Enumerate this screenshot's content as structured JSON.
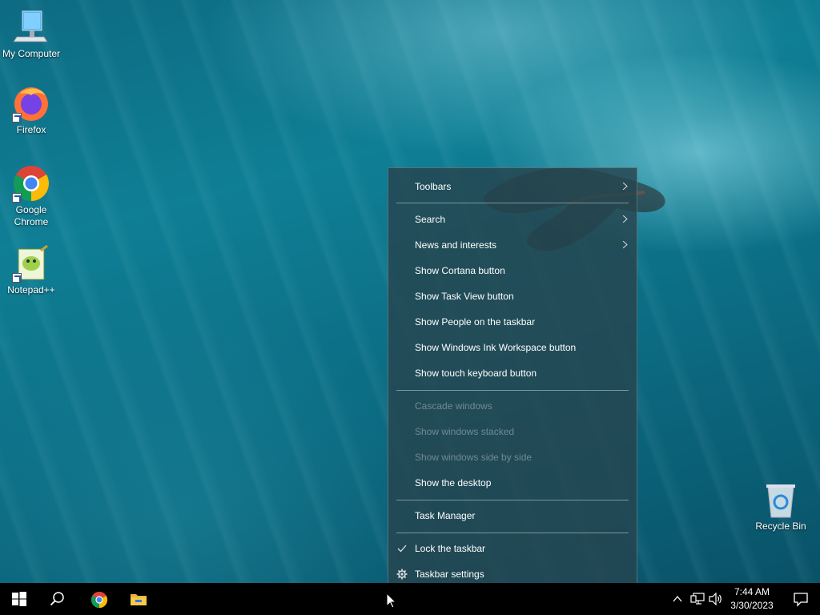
{
  "desktop": {
    "icons": [
      {
        "label": "My Computer",
        "icon": "computer-icon"
      },
      {
        "label": "Firefox",
        "icon": "firefox-icon"
      },
      {
        "label": "Google Chrome",
        "icon": "chrome-icon"
      },
      {
        "label": "Notepad++",
        "icon": "notepadpp-icon"
      },
      {
        "label": "Recycle Bin",
        "icon": "recycle-bin-icon"
      }
    ]
  },
  "context_menu": {
    "items": [
      {
        "label": "Toolbars",
        "submenu": true
      },
      {
        "label": "Search",
        "submenu": true
      },
      {
        "label": "News and interests",
        "submenu": true
      },
      {
        "label": "Show Cortana button"
      },
      {
        "label": "Show Task View button"
      },
      {
        "label": "Show People on the taskbar"
      },
      {
        "label": "Show Windows Ink Workspace button"
      },
      {
        "label": "Show touch keyboard button"
      },
      {
        "label": "Cascade windows",
        "disabled": true
      },
      {
        "label": "Show windows stacked",
        "disabled": true
      },
      {
        "label": "Show windows side by side",
        "disabled": true
      },
      {
        "label": "Show the desktop"
      },
      {
        "label": "Task Manager"
      },
      {
        "label": "Lock the taskbar",
        "checked": true
      },
      {
        "label": "Taskbar settings",
        "icon": "gear-icon"
      }
    ]
  },
  "taskbar": {
    "pinned": [
      "start-icon",
      "search-icon",
      "chrome-icon",
      "file-explorer-icon"
    ],
    "tray": {
      "time": "7:44 AM",
      "date": "3/30/2023",
      "icons": [
        "chevron-up-icon",
        "network-icon",
        "volume-icon",
        "notification-icon"
      ]
    }
  },
  "colors": {
    "menu_bg": "#26444e",
    "taskbar_bg": "#000000",
    "water": "#0f7f95"
  }
}
